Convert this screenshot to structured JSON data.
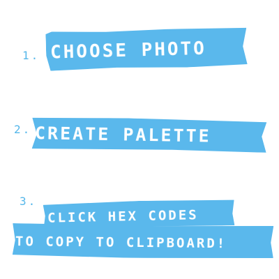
{
  "steps": [
    {
      "number": "1.",
      "lines": [
        "CHOOSE PHOTO"
      ]
    },
    {
      "number": "2.",
      "lines": [
        "CREATE PALETTE"
      ]
    },
    {
      "number": "3.",
      "lines": [
        "CLICK HEX CODES",
        "TO COPY TO CLIPBOARD!"
      ]
    }
  ],
  "colors": {
    "tape": "#5ab8ec",
    "number": "#55b7ea",
    "text": "#ffffff",
    "background": "#ffffff"
  }
}
